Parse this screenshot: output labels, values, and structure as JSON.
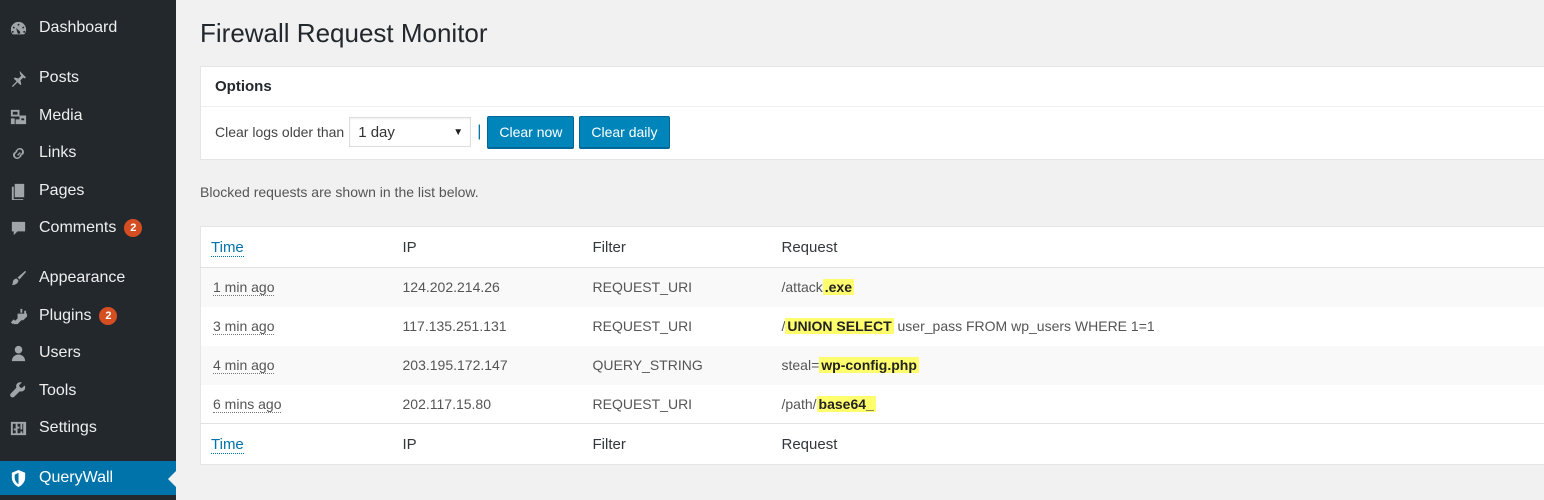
{
  "sidebar": {
    "items": [
      {
        "label": "Dashboard",
        "icon": "dashboard-icon"
      },
      {
        "label": "Posts",
        "icon": "pin-icon"
      },
      {
        "label": "Media",
        "icon": "media-icon"
      },
      {
        "label": "Links",
        "icon": "link-icon"
      },
      {
        "label": "Pages",
        "icon": "pages-icon"
      },
      {
        "label": "Comments",
        "icon": "comment-icon",
        "badge": "2"
      },
      {
        "label": "Appearance",
        "icon": "brush-icon"
      },
      {
        "label": "Plugins",
        "icon": "plugin-icon",
        "badge": "2"
      },
      {
        "label": "Users",
        "icon": "user-icon"
      },
      {
        "label": "Tools",
        "icon": "wrench-icon"
      },
      {
        "label": "Settings",
        "icon": "settings-icon"
      },
      {
        "label": "QueryWall",
        "icon": "shield-icon",
        "active": true
      }
    ]
  },
  "page": {
    "title": "Firewall Request Monitor",
    "intro": "Blocked requests are shown in the list below."
  },
  "options": {
    "heading": "Options",
    "clear_label": "Clear logs older than",
    "selected_age": "1 day",
    "separator": "|",
    "clear_now_label": "Clear now",
    "clear_daily_label": "Clear daily"
  },
  "table": {
    "headers": {
      "time": "Time",
      "ip": "IP",
      "filter": "Filter",
      "request": "Request"
    },
    "rows": [
      {
        "time": "1 min ago",
        "ip": "124.202.214.26",
        "filter": "REQUEST_URI",
        "request_plain": "/attack",
        "request_match": ".exe",
        "request_rest": ""
      },
      {
        "time": "3 min ago",
        "ip": "117.135.251.131",
        "filter": "REQUEST_URI",
        "request_plain": "/",
        "request_match": "UNION SELECT",
        "request_rest": " user_pass FROM wp_users WHERE 1=1"
      },
      {
        "time": "4 min ago",
        "ip": "203.195.172.147",
        "filter": "QUERY_STRING",
        "request_plain": "steal=",
        "request_match": "wp-config.php",
        "request_rest": ""
      },
      {
        "time": "6 mins ago",
        "ip": "202.117.15.80",
        "filter": "REQUEST_URI",
        "request_plain": "/path/",
        "request_match": "base64_",
        "request_rest": ""
      }
    ]
  },
  "colors": {
    "sidebar_bg": "#23282d",
    "accent": "#0073aa",
    "highlight": "#ffff6e",
    "badge": "#d54e21"
  }
}
